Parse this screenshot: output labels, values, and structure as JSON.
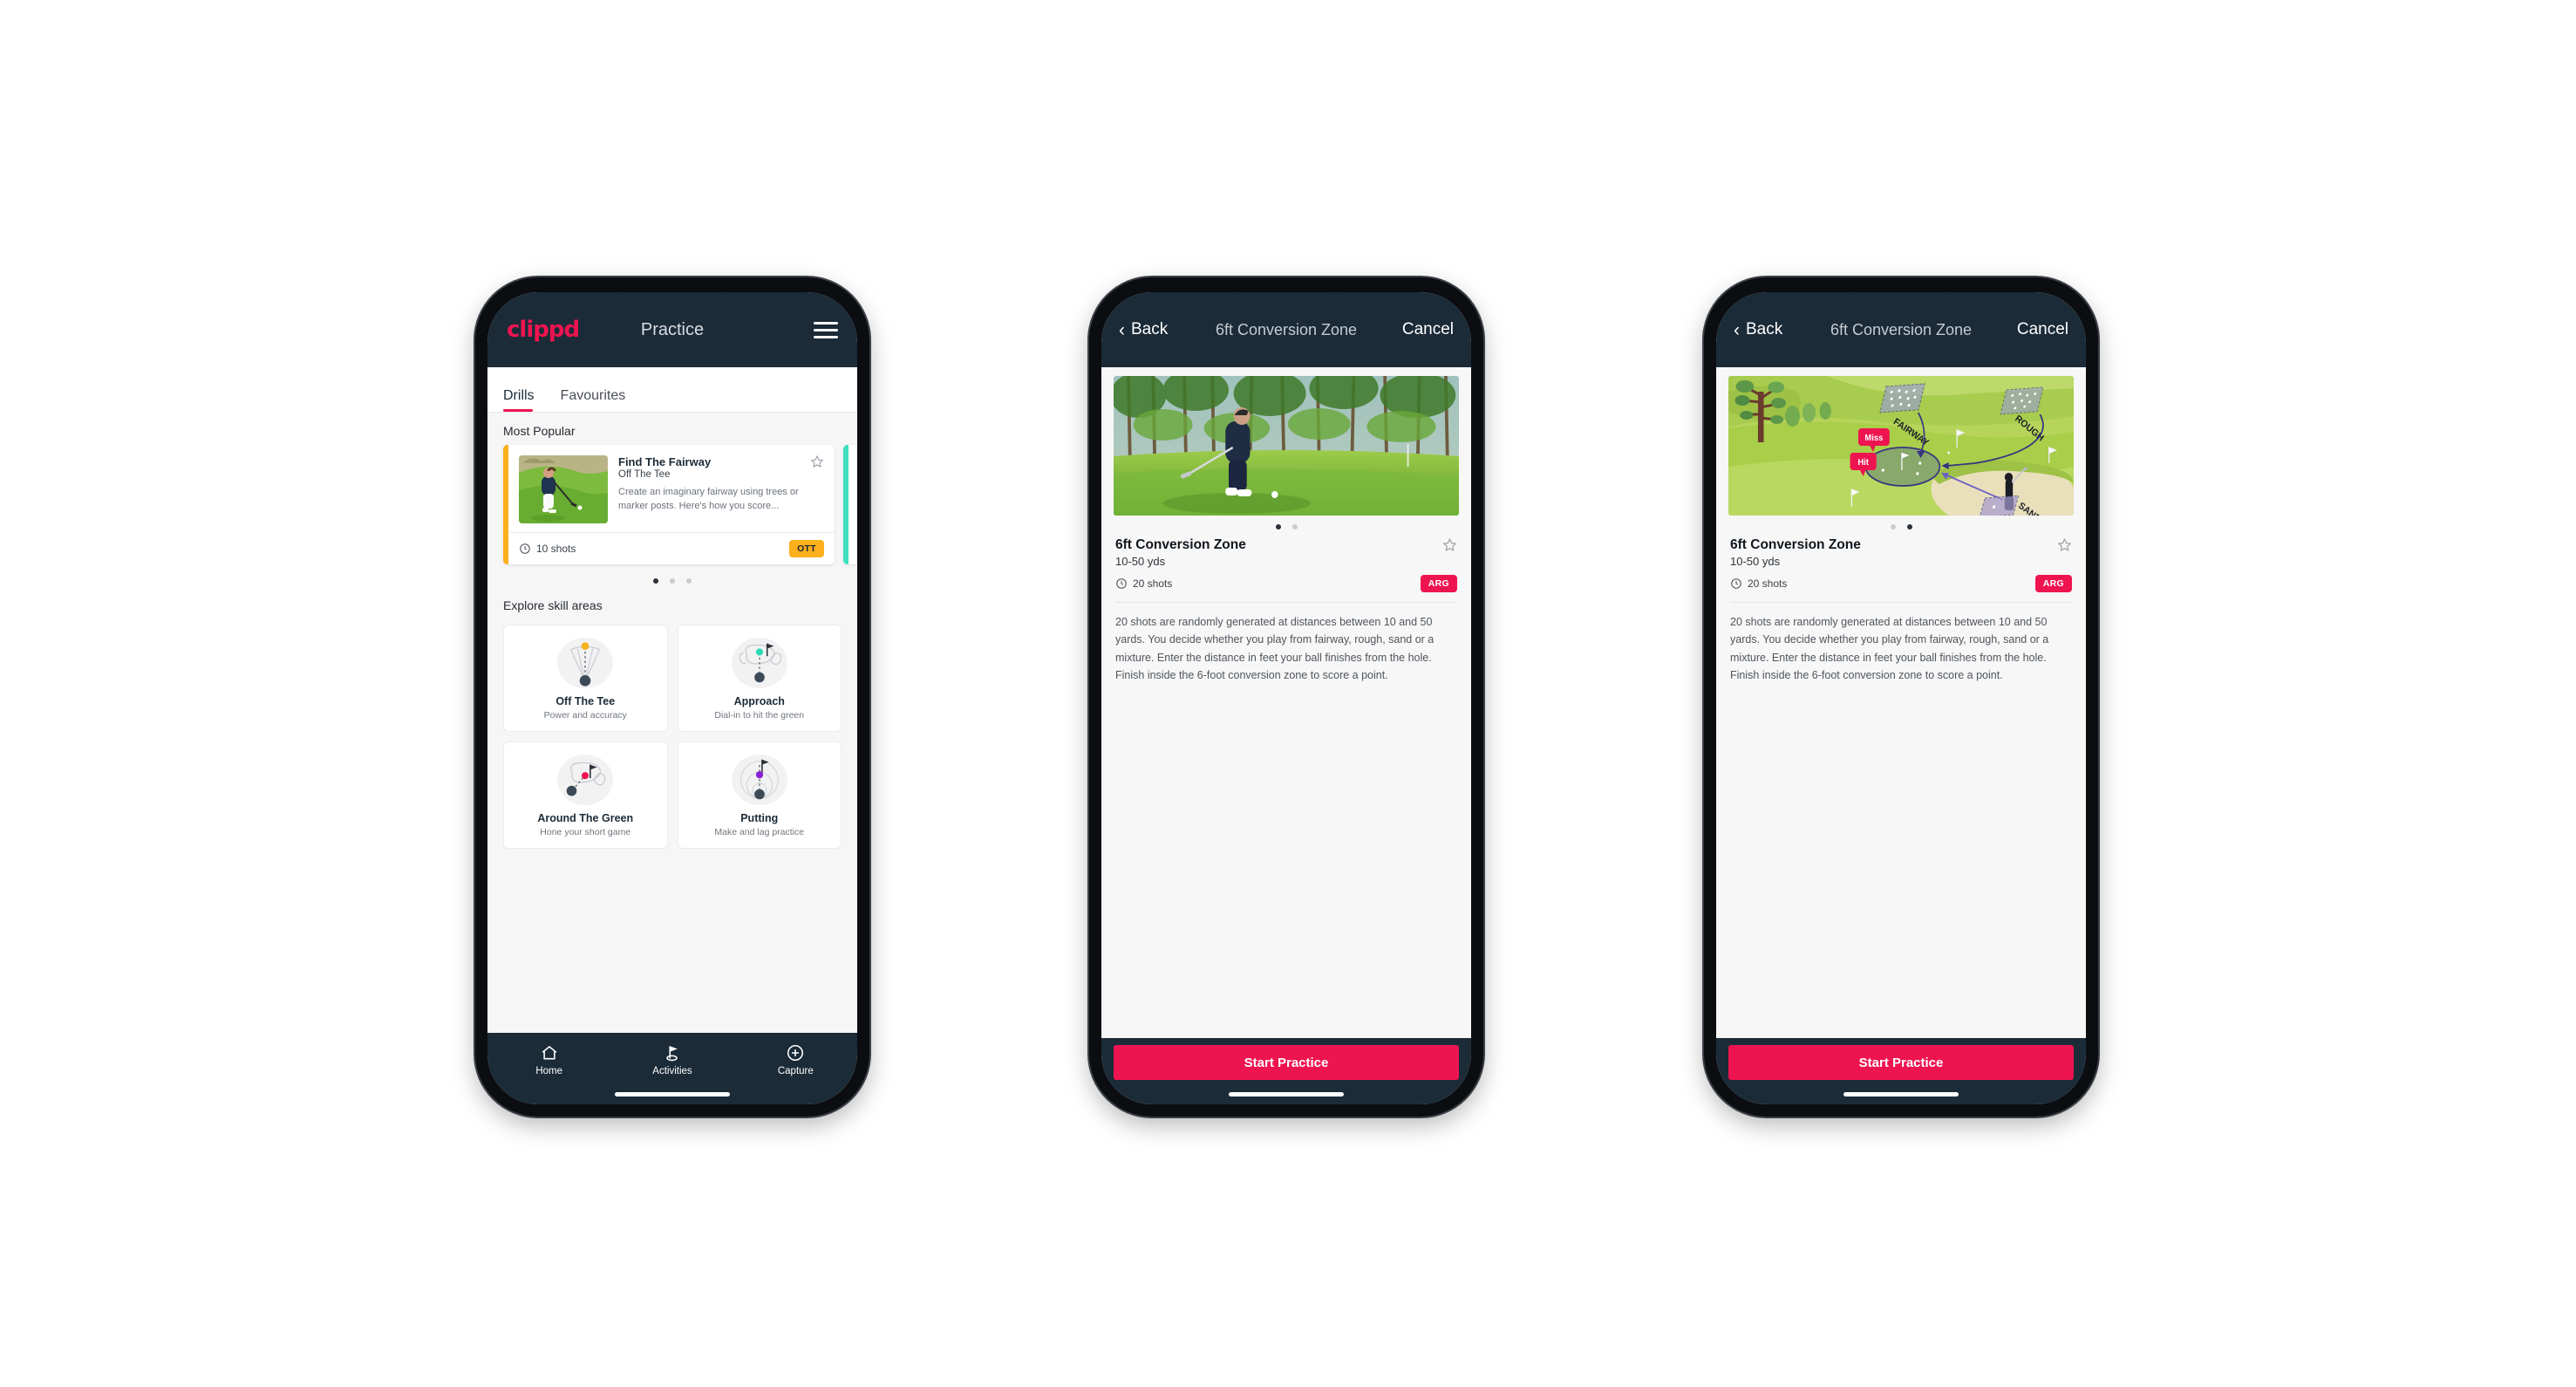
{
  "app": {
    "brand": "clippd",
    "accent": "#ee1450",
    "header_bg": "#1b2b38"
  },
  "phone1": {
    "header": {
      "title": "Practice",
      "menu_icon": "hamburger-menu-icon"
    },
    "tabs": [
      {
        "label": "Drills",
        "active": true
      },
      {
        "label": "Favourites",
        "active": false
      }
    ],
    "most_popular": {
      "section_label": "Most Popular",
      "card": {
        "title": "Find The Fairway",
        "subtitle": "Off The Tee",
        "description": "Create an imaginary fairway using trees or marker posts. Here's how you score...",
        "shots": "10 shots",
        "badge": "OTT",
        "badge_color": "#fbb01c",
        "stripe_color": "#fbb01c",
        "next_stripe_color": "#3fe0c0",
        "favourite_icon": "star-outline-icon",
        "shots_icon": "clock-icon"
      },
      "dots": {
        "count": 3,
        "active": 0
      }
    },
    "skill_areas": {
      "section_label": "Explore skill areas",
      "items": [
        {
          "name": "Off The Tee",
          "desc": "Power and accuracy",
          "icon": "tee-shot-cone-icon",
          "dot_color": "#f5b11f"
        },
        {
          "name": "Approach",
          "desc": "Dial-in to hit the green",
          "icon": "approach-green-icon",
          "dot_color": "#2ed9b5"
        },
        {
          "name": "Around The Green",
          "desc": "Hone your short game",
          "icon": "chip-green-icon",
          "dot_color": "#ee1450"
        },
        {
          "name": "Putting",
          "desc": "Make and lag practice",
          "icon": "putting-rings-icon",
          "dot_color": "#8a1fd4"
        }
      ]
    },
    "tabbar": [
      {
        "label": "Home",
        "icon": "home-icon",
        "active": false
      },
      {
        "label": "Activities",
        "icon": "golf-flag-icon",
        "active": true
      },
      {
        "label": "Capture",
        "icon": "plus-circle-icon",
        "active": false
      }
    ]
  },
  "phone2": {
    "nav": {
      "back": "Back",
      "title": "6ft Conversion Zone",
      "cancel": "Cancel",
      "back_icon": "chevron-left-icon"
    },
    "hero": {
      "type": "photo",
      "alt": "golfer-chipping-photo"
    },
    "dots": {
      "count": 2,
      "active": 0
    },
    "detail": {
      "title": "6ft Conversion Zone",
      "yardage": "10-50 yds",
      "shots": "20 shots",
      "badge": "ARG",
      "badge_color": "#ee1450",
      "favourite_icon": "star-outline-icon",
      "shots_icon": "clock-icon",
      "description": "20 shots are randomly generated at distances between 10 and 50 yards. You decide whether you play from fairway, rough, sand or a mixture. Enter the distance in feet your ball finishes from the hole. Finish inside the 6-foot conversion zone to score a point."
    },
    "cta": "Start Practice"
  },
  "phone3": {
    "nav": {
      "back": "Back",
      "title": "6ft Conversion Zone",
      "cancel": "Cancel",
      "back_icon": "chevron-left-icon"
    },
    "hero": {
      "type": "illustration",
      "alt": "golf-course-diagram",
      "labels": {
        "fairway": "FAIRWAY",
        "rough": "ROUGH",
        "sand": "SAND",
        "miss": "Miss",
        "hit": "Hit"
      }
    },
    "dots": {
      "count": 2,
      "active": 1
    },
    "detail": {
      "title": "6ft Conversion Zone",
      "yardage": "10-50 yds",
      "shots": "20 shots",
      "badge": "ARG",
      "badge_color": "#ee1450",
      "favourite_icon": "star-outline-icon",
      "shots_icon": "clock-icon",
      "description": "20 shots are randomly generated at distances between 10 and 50 yards. You decide whether you play from fairway, rough, sand or a mixture. Enter the distance in feet your ball finishes from the hole. Finish inside the 6-foot conversion zone to score a point."
    },
    "cta": "Start Practice"
  }
}
